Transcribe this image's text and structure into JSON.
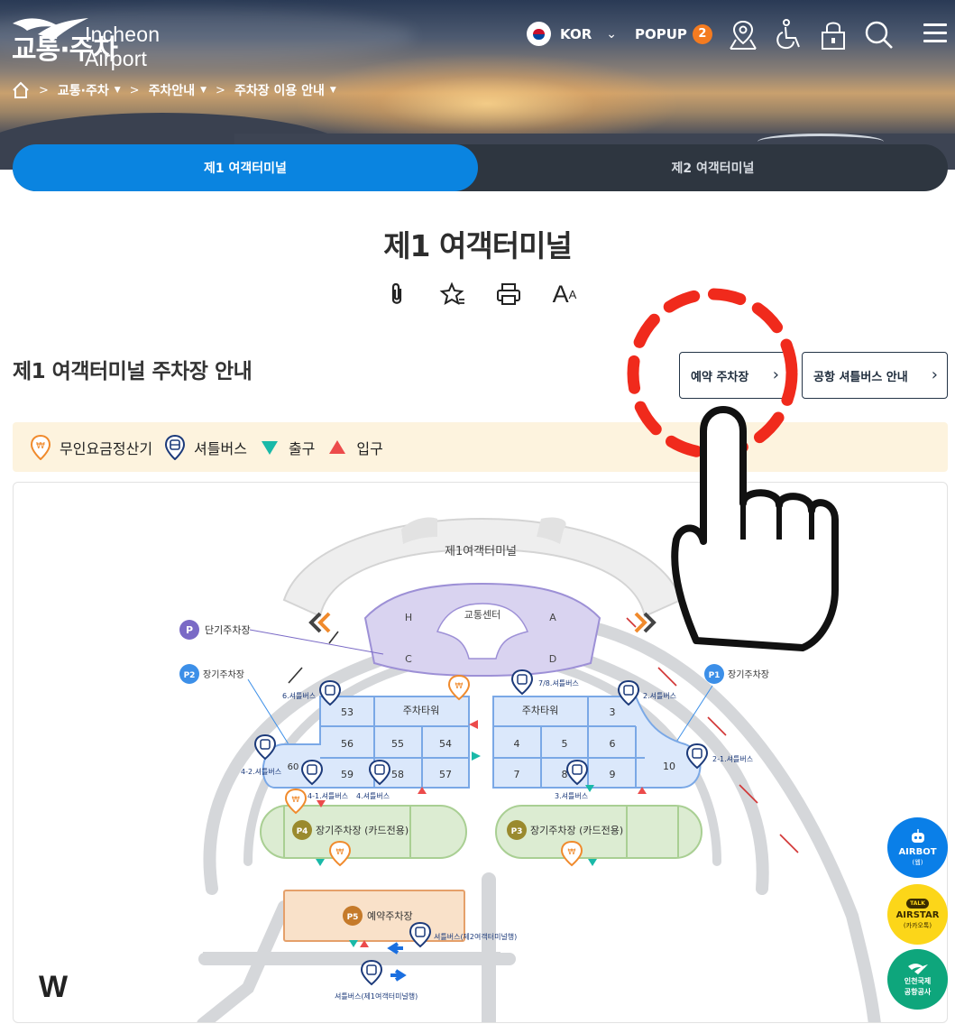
{
  "header": {
    "logo_text": "Incheon Airport",
    "section_title": "교통·주차",
    "language": "KOR",
    "popup_label": "POPUP",
    "popup_count": "2"
  },
  "breadcrumb": {
    "items": [
      "교통·주차",
      "주차안내",
      "주차장 이용 안내"
    ]
  },
  "tabs": [
    {
      "label": "제1 여객터미널",
      "active": true
    },
    {
      "label": "제2 여객터미널",
      "active": false
    }
  ],
  "page": {
    "title": "제1 여객터미널",
    "font_tool_large": "A",
    "font_tool_small": "A",
    "subtitle": "제1 여객터미널 주차장 안내",
    "btn_reserve": "예약 주차장",
    "btn_shuttle": "공항 셔틀버스 안내"
  },
  "legend": {
    "items": [
      "무인요금정산기",
      "셔틀버스",
      "출구",
      "입구"
    ]
  },
  "map": {
    "terminal": "제1여객터미널",
    "transport_center": "교통센터",
    "gates": [
      "H",
      "A",
      "C",
      "D"
    ],
    "short_term": "단기주차장",
    "long_term": "장기주차장",
    "p_badge": "P",
    "p1": "P1",
    "p2": "P2",
    "p3_label": "장기주차장 (카드전용)",
    "p4_label": "장기주차장 (카드전용)",
    "p3": "P3",
    "p4": "P4",
    "p5": "P5",
    "p5_label": "예약주차장",
    "tower_left": "주차타워",
    "tower_right": "주차타워",
    "left_cells": [
      "53",
      "56",
      "55",
      "54",
      "59",
      "58",
      "57",
      "60"
    ],
    "right_cells": [
      "3",
      "4",
      "5",
      "6",
      "7",
      "8",
      "9",
      "10"
    ],
    "shuttle_labels": {
      "s6": "6.셔틀버스",
      "s78": "7/8.셔틀버스",
      "s2": "2.셔틀버스",
      "s21": "2-1.셔틀버스",
      "s42": "4-2.셔틀버스",
      "s41": "4-1.셔틀버스",
      "s4": "4.셔틀버스",
      "s3": "3.셔틀버스",
      "s_t2": "셔틀버스(제2여객터미널행)",
      "s_t1": "셔틀버스(제1여객터미널행)"
    },
    "w_mark": "W"
  },
  "fabs": {
    "airbot": "AIRBOT",
    "airbot_sub": "(웹)",
    "airstar": "AIRSTAR",
    "airstar_sub": "(카카오톡)",
    "talk": "TALK",
    "corp_line1": "인천국제",
    "corp_line2": "공항공사"
  },
  "colors": {
    "accent": "#0a84e0",
    "tab_bg": "#2e3640",
    "legend_bg": "#fdf3de",
    "p5_fill": "#f9e1c9",
    "p34_fill": "#dcecd2",
    "tower_fill": "#dbe8fb",
    "short_fill": "#d9d3f0",
    "hint_red": "#f02a1c"
  }
}
